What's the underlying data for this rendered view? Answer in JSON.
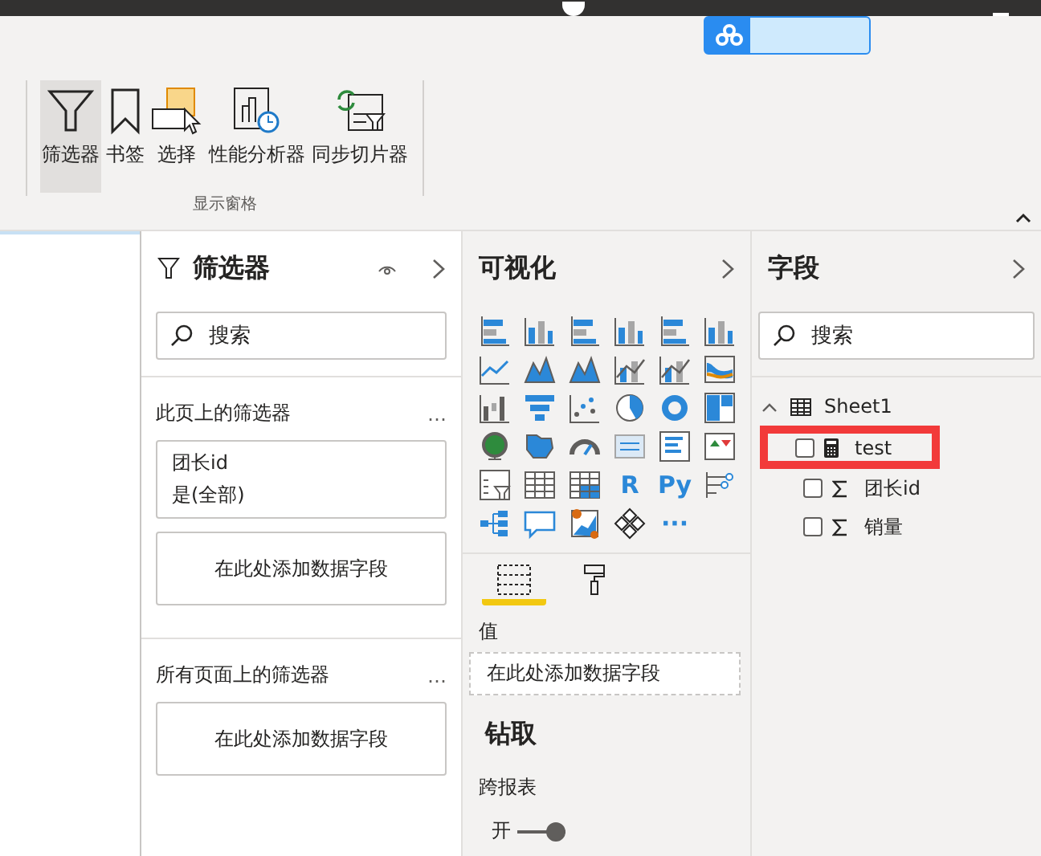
{
  "ribbon": {
    "buttons": [
      {
        "label": "筛选器",
        "kind": "filter",
        "selected": true
      },
      {
        "label": "书签",
        "kind": "bookmark",
        "selected": false
      },
      {
        "label": "选择",
        "kind": "selection",
        "selected": false
      },
      {
        "label": "性能分析器",
        "kind": "performance",
        "selected": false
      },
      {
        "label": "同步切片器",
        "kind": "sync",
        "selected": false
      }
    ],
    "group_label": "显示窗格"
  },
  "filters_pane": {
    "title": "筛选器",
    "search": {
      "placeholder": "搜索"
    },
    "page_section": {
      "title": "此页上的筛选器",
      "more": "…",
      "cards": [
        {
          "kind": "filter",
          "field": "团长id",
          "value": "是(全部)"
        },
        {
          "kind": "drop",
          "text": "在此处添加数据字段"
        }
      ]
    },
    "all_pages_section": {
      "title": "所有页面上的筛选器",
      "more": "…",
      "cards": [
        {
          "kind": "drop",
          "text": "在此处添加数据字段"
        }
      ]
    }
  },
  "visualizations_pane": {
    "title": "可视化",
    "visuals": [
      {
        "kind": "bar"
      },
      {
        "kind": "column"
      },
      {
        "kind": "bar"
      },
      {
        "kind": "column"
      },
      {
        "kind": "bar"
      },
      {
        "kind": "column"
      },
      {
        "kind": "line"
      },
      {
        "kind": "area"
      },
      {
        "kind": "area"
      },
      {
        "kind": "combo"
      },
      {
        "kind": "combo"
      },
      {
        "kind": "ribbon"
      },
      {
        "kind": "waterfall"
      },
      {
        "kind": "funnel"
      },
      {
        "kind": "scatter"
      },
      {
        "kind": "pie"
      },
      {
        "kind": "donut"
      },
      {
        "kind": "treemap"
      },
      {
        "kind": "globe"
      },
      {
        "kind": "map"
      },
      {
        "kind": "gauge"
      },
      {
        "kind": "card"
      },
      {
        "kind": "multirow"
      },
      {
        "kind": "kpi"
      },
      {
        "kind": "slicer"
      },
      {
        "kind": "table"
      },
      {
        "kind": "matrix"
      },
      {
        "kind": "text",
        "label": "R"
      },
      {
        "kind": "text",
        "label": "Py"
      },
      {
        "kind": "influencers"
      },
      {
        "kind": "tree"
      },
      {
        "kind": "bubble"
      },
      {
        "kind": "arcmap"
      },
      {
        "kind": "diamond"
      },
      {
        "kind": "text",
        "label": "···"
      }
    ],
    "tabs": [
      {
        "kind": "fields",
        "selected": true
      },
      {
        "kind": "format",
        "selected": false
      }
    ],
    "values_label": "值",
    "values_drop": "在此处添加数据字段",
    "drillthrough_title": "钻取",
    "cross_report_label": "跨报表",
    "cross_report_toggle": {
      "label": "开",
      "on": true
    }
  },
  "fields_pane": {
    "title": "字段",
    "search": {
      "placeholder": "搜索"
    },
    "tables": [
      {
        "name": "Sheet1",
        "expanded": true,
        "children": [
          {
            "name": "test",
            "kind": "measure",
            "checked": false,
            "highlighted": true
          },
          {
            "name": "团长id",
            "kind": "sum",
            "checked": false,
            "highlighted": false
          },
          {
            "name": "销量",
            "kind": "sum",
            "checked": false,
            "highlighted": false
          }
        ]
      }
    ]
  }
}
